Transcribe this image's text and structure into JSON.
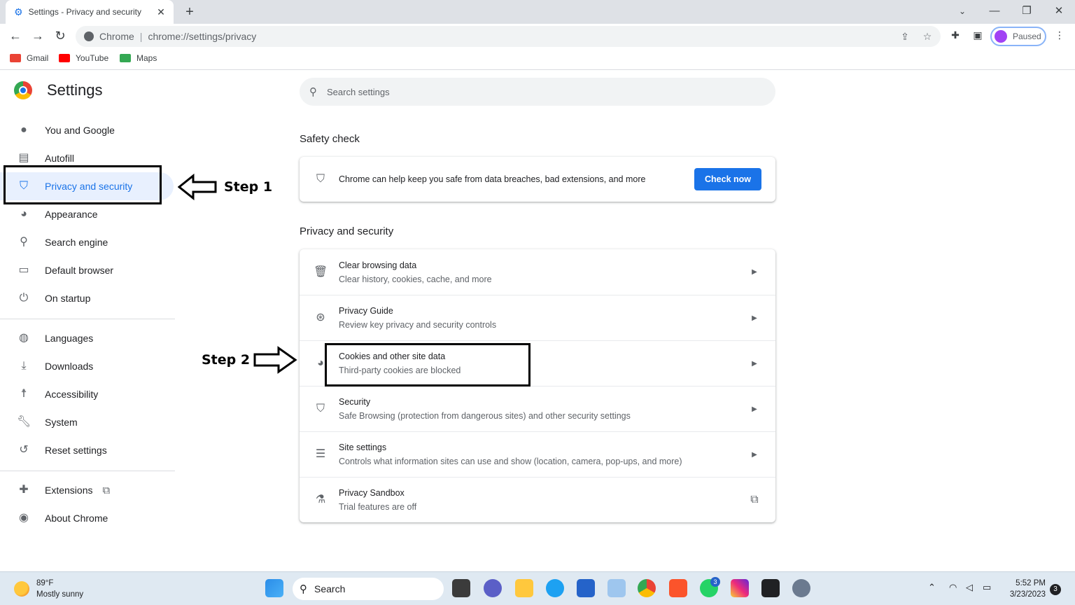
{
  "browser": {
    "tab_title": "Settings - Privacy and security",
    "omnibox_chrome_label": "Chrome",
    "omnibox_separator": "|",
    "url": "chrome://settings/privacy",
    "profile_label": "Paused",
    "bookmarks": [
      {
        "label": "Gmail",
        "icon": "gmail-icon",
        "color": "#ea4335"
      },
      {
        "label": "YouTube",
        "icon": "youtube-icon",
        "color": "#ff0000"
      },
      {
        "label": "Maps",
        "icon": "maps-icon",
        "color": "#34a853"
      }
    ]
  },
  "settings": {
    "title": "Settings",
    "search_placeholder": "Search settings",
    "nav": [
      {
        "label": "You and Google",
        "icon": "person-icon"
      },
      {
        "label": "Autofill",
        "icon": "clipboard-icon"
      },
      {
        "label": "Privacy and security",
        "icon": "shield-icon",
        "active": true
      },
      {
        "label": "Appearance",
        "icon": "palette-icon"
      },
      {
        "label": "Search engine",
        "icon": "search-icon"
      },
      {
        "label": "Default browser",
        "icon": "browser-icon"
      },
      {
        "label": "On startup",
        "icon": "power-icon"
      },
      {
        "label": "Languages",
        "icon": "globe-icon"
      },
      {
        "label": "Downloads",
        "icon": "download-icon"
      },
      {
        "label": "Accessibility",
        "icon": "accessibility-icon"
      },
      {
        "label": "System",
        "icon": "wrench-icon"
      },
      {
        "label": "Reset settings",
        "icon": "history-icon"
      },
      {
        "label": "Extensions",
        "icon": "puzzle-icon"
      },
      {
        "label": "About Chrome",
        "icon": "chrome-icon"
      }
    ],
    "safety_check": {
      "heading": "Safety check",
      "text": "Chrome can help keep you safe from data breaches, bad extensions, and more",
      "button": "Check now"
    },
    "privacy": {
      "heading": "Privacy and security",
      "rows": [
        {
          "title": "Clear browsing data",
          "subtitle": "Clear history, cookies, cache, and more",
          "icon": "trash-icon"
        },
        {
          "title": "Privacy Guide",
          "subtitle": "Review key privacy and security controls",
          "icon": "compass-icon"
        },
        {
          "title": "Cookies and other site data",
          "subtitle": "Third-party cookies are blocked",
          "icon": "cookie-icon"
        },
        {
          "title": "Security",
          "subtitle": "Safe Browsing (protection from dangerous sites) and other security settings",
          "icon": "shield-icon"
        },
        {
          "title": "Site settings",
          "subtitle": "Controls what information sites can use and show (location, camera, pop-ups, and more)",
          "icon": "sliders-icon"
        },
        {
          "title": "Privacy Sandbox",
          "subtitle": "Trial features are off",
          "icon": "flask-icon"
        }
      ]
    }
  },
  "annotations": {
    "step1": "Step 1",
    "step2": "Step 2"
  },
  "taskbar": {
    "temperature": "89°F",
    "weather": "Mostly sunny",
    "search_label": "Search",
    "time": "5:52 PM",
    "date": "3/23/2023",
    "notification_count": "3",
    "whatsapp_badge": "3"
  },
  "colors": {
    "accent": "#1a73e8",
    "active_nav_bg": "#e8f0fe"
  }
}
